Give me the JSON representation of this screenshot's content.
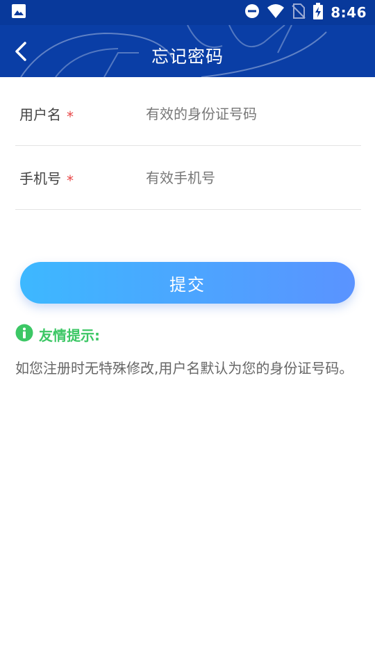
{
  "status_bar": {
    "time": "8:46",
    "icons": [
      "image-icon",
      "do-not-disturb-icon",
      "wifi-icon",
      "no-sim-icon",
      "battery-charging-icon"
    ]
  },
  "header": {
    "title": "忘记密码",
    "back_icon": "chevron-left-icon",
    "background_color": "#0a3ea6"
  },
  "form": {
    "username": {
      "label": "用户名",
      "required_mark": "*",
      "value": "",
      "placeholder": "有效的身份证号码"
    },
    "phone": {
      "label": "手机号",
      "required_mark": "*",
      "value": "",
      "placeholder": "有效手机号"
    }
  },
  "submit": {
    "label": "提交"
  },
  "tip": {
    "icon": "info-icon",
    "title": "友情提示:",
    "text": "如您注册时无特殊修改,用户名默认为您的身份证号码。",
    "color": "#3cc765"
  }
}
